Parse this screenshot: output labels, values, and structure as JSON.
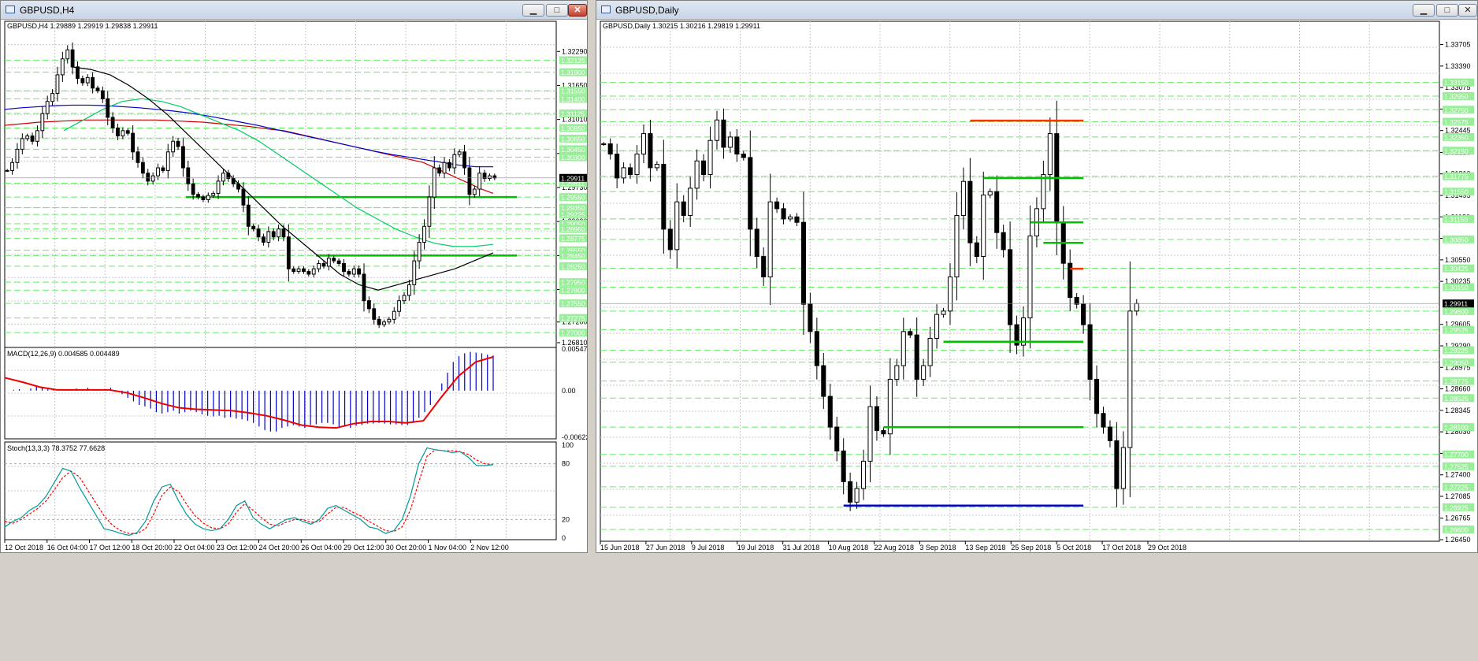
{
  "colors": {
    "ema": "#0000cc",
    "sma": "#cc0000",
    "ma50": "#000000",
    "ma20": "#00cc66",
    "level_green": "#00c000",
    "level_red": "#ff3300",
    "level_blue": "#0000cc",
    "dash_green": "#66ee66",
    "macd_hist": "#0000cc",
    "macd_signal": "#ee0000",
    "stoch_main": "#009999",
    "stoch_signal": "#ff0000",
    "badge": "#99ee99"
  },
  "left": {
    "title": "GBPUSD,H4",
    "info": "GBPUSD,H4  1.29889 1.29919 1.29838 1.29911",
    "price_min": 1.2681,
    "price_max": 1.3265,
    "price_axis": [
      "1.32290",
      "1.31650",
      "1.31010",
      "1.30370",
      "1.29730",
      "1.29090",
      "1.28450",
      "1.27810",
      "1.27200",
      "1.26810"
    ],
    "price_badges": [
      "1.32125",
      "1.31900",
      "1.31550",
      "1.31400",
      "1.31125",
      "1.30850",
      "1.30650",
      "1.30450",
      "1.30300",
      "1.29811",
      "1.29550",
      "1.29350",
      "1.29225",
      "1.29050",
      "1.28950",
      "1.28775",
      "1.28550",
      "1.28450",
      "1.28250",
      "1.27950",
      "1.27800",
      "1.27550",
      "1.27275",
      "1.27000"
    ],
    "current_price": "1.29911",
    "green_levels": [
      1.2955,
      1.2845
    ],
    "candles": [
      1.3005,
      1.302,
      1.3045,
      1.3065,
      1.307,
      1.306,
      1.308,
      1.3112,
      1.3135,
      1.315,
      1.3185,
      1.3215,
      1.3232,
      1.32,
      1.3178,
      1.317,
      1.318,
      1.316,
      1.3155,
      1.314,
      1.3105,
      1.3085,
      1.307,
      1.308,
      1.3075,
      1.304,
      1.302,
      1.3,
      1.2985,
      1.2995,
      1.301,
      1.3005,
      1.304,
      1.306,
      1.305,
      1.301,
      1.298,
      1.296,
      1.2955,
      1.295,
      1.2958,
      1.2962,
      1.2985,
      1.3,
      1.299,
      1.298,
      1.297,
      1.294,
      1.29,
      1.2895,
      1.288,
      1.287,
      1.289,
      1.288,
      1.2895,
      1.288,
      1.282,
      1.2815,
      1.282,
      1.2815,
      1.281,
      1.282,
      1.283,
      1.2825,
      1.284,
      1.2835,
      1.283,
      1.2815,
      1.281,
      1.282,
      1.281,
      1.276,
      1.2745,
      1.2725,
      1.2715,
      1.272,
      1.2725,
      1.274,
      1.276,
      1.277,
      1.279,
      1.2835,
      1.287,
      1.29,
      1.2955,
      1.301,
      1.3,
      1.302,
      1.301,
      1.3035,
      1.304,
      1.301,
      1.296,
      1.297,
      1.3,
      1.299,
      1.2995,
      1.2991
    ],
    "sma": [
      1.309,
      1.3092,
      1.3094,
      1.3096,
      1.3097,
      1.3098,
      1.3099,
      1.31,
      1.31,
      1.31,
      1.31,
      1.31,
      1.31,
      1.31,
      1.3099,
      1.3098,
      1.3097,
      1.3096,
      1.3094,
      1.3092,
      1.309,
      1.3088,
      1.3085,
      1.3082,
      1.308,
      1.3075,
      1.307,
      1.3065,
      1.306,
      1.3055,
      1.305,
      1.3045,
      1.304,
      1.3035,
      1.303,
      1.3025,
      1.302,
      1.301,
      1.3,
      1.299,
      1.298,
      1.297,
      1.2962
    ],
    "ema": [
      1.312,
      1.3123,
      1.3125,
      1.3127,
      1.3128,
      1.3128,
      1.3127,
      1.3125,
      1.3123,
      1.312,
      1.3117,
      1.3113,
      1.3108,
      1.3102,
      1.3096,
      1.309,
      1.3083,
      1.3076,
      1.3069,
      1.3062,
      1.3055,
      1.3048,
      1.3041,
      1.3035,
      1.303,
      1.3025,
      1.302,
      1.3015,
      1.3012,
      1.3012
    ],
    "ma20": [
      1.308,
      1.31,
      1.312,
      1.3135,
      1.314,
      1.3135,
      1.3125,
      1.311,
      1.3095,
      1.308,
      1.306,
      1.3035,
      1.301,
      1.2985,
      1.296,
      1.2935,
      1.2915,
      1.2895,
      1.288,
      1.2868,
      1.2862,
      1.2862,
      1.2866
    ],
    "ma50": [
      1.32,
      1.3195,
      1.3185,
      1.3165,
      1.314,
      1.311,
      1.3075,
      1.304,
      1.3005,
      1.297,
      1.2935,
      1.29,
      1.287,
      1.284,
      1.281,
      1.279,
      1.278,
      1.279,
      1.28,
      1.281,
      1.282,
      1.2835,
      1.285
    ],
    "macd": {
      "label": "MACD(12,26,9) 0.004585 0.004489",
      "axis": [
        "0.005474",
        "0.00",
        "-0.006227"
      ],
      "min": -0.0065,
      "max": 0.0058,
      "hist": [
        -0.0,
        0.0001,
        0.0002,
        0.0,
        0.0003,
        0.0006,
        0.0004,
        0.0003,
        0.0002,
        0.0,
        0.0001,
        0.0002,
        0.0003,
        0.0002,
        0.0004,
        0.0002,
        0.0001,
        0.0002,
        0.0004,
        0.0,
        -0.0005,
        -0.001,
        -0.0015,
        -0.002,
        -0.0022,
        -0.0025,
        -0.003,
        -0.0032,
        -0.003,
        -0.0028,
        -0.0032,
        -0.003,
        -0.0028,
        -0.003,
        -0.0033,
        -0.0035,
        -0.0036,
        -0.0035,
        -0.0038,
        -0.0037,
        -0.0039,
        -0.004,
        -0.0042,
        -0.0045,
        -0.005,
        -0.0055,
        -0.0057,
        -0.0057,
        -0.0052,
        -0.005,
        -0.0048,
        -0.005,
        -0.0052,
        -0.0048,
        -0.0047,
        -0.0045,
        -0.0045,
        -0.0047,
        -0.005,
        -0.005,
        -0.0052,
        -0.0049,
        -0.0048,
        -0.0046,
        -0.0046,
        -0.0045,
        -0.0046,
        -0.0047,
        -0.0047,
        -0.0048,
        -0.0048,
        -0.0045,
        -0.0038,
        -0.003,
        -0.002,
        0.0,
        0.001,
        0.0025,
        0.004,
        0.0048,
        0.0052,
        0.0054,
        0.0053,
        0.0052,
        0.005,
        0.0049
      ],
      "signal": [
        0.0018,
        0.0012,
        0.0005,
        0.0001,
        0.0001,
        0.0001,
        0.0001,
        -0.0003,
        -0.001,
        -0.0018,
        -0.0024,
        -0.0026,
        -0.0027,
        -0.0028,
        -0.0031,
        -0.0035,
        -0.0041,
        -0.0048,
        -0.0051,
        -0.0052,
        -0.0046,
        -0.0043,
        -0.0043,
        -0.0045,
        -0.0042,
        -0.001,
        0.002,
        0.004,
        0.0047
      ]
    },
    "stoch": {
      "label": "Stoch(13,3,3) 78.3752 77.6628",
      "axis": [
        "100",
        "80",
        "20",
        "0"
      ],
      "main": [
        12,
        18,
        22,
        30,
        35,
        45,
        60,
        75,
        72,
        55,
        40,
        25,
        10,
        8,
        5,
        3,
        6,
        18,
        40,
        55,
        58,
        40,
        25,
        15,
        10,
        8,
        10,
        20,
        35,
        40,
        22,
        15,
        10,
        15,
        20,
        22,
        18,
        15,
        20,
        32,
        35,
        30,
        25,
        20,
        12,
        10,
        5,
        8,
        20,
        45,
        80,
        97,
        95,
        94,
        92,
        93,
        87,
        78,
        78,
        79
      ],
      "signal": [
        18,
        16,
        20,
        26,
        32,
        40,
        52,
        65,
        72,
        66,
        52,
        38,
        24,
        14,
        8,
        5,
        5,
        10,
        26,
        46,
        55,
        50,
        36,
        24,
        16,
        11,
        10,
        15,
        28,
        37,
        30,
        22,
        15,
        13,
        17,
        20,
        20,
        17,
        18,
        26,
        33,
        33,
        28,
        24,
        18,
        13,
        8,
        7,
        12,
        30,
        60,
        88,
        95,
        94,
        94,
        93,
        90,
        84,
        80,
        79
      ]
    },
    "time_labels": [
      "12 Oct 2018",
      "16 Oct 04:00",
      "17 Oct 12:00",
      "18 Oct 20:00",
      "22 Oct 04:00",
      "23 Oct 12:00",
      "24 Oct 20:00",
      "26 Oct 04:00",
      "29 Oct 12:00",
      "30 Oct 20:00",
      "1 Nov 04:00",
      "2 Nov 12:00"
    ]
  },
  "right": {
    "title": "GBPUSD,Daily",
    "info": "GBPUSD,Daily  1.30215 1.30216 1.29819 1.29911",
    "price_min": 1.2645,
    "price_max": 1.34,
    "price_axis": [
      "1.33705",
      "1.33390",
      "1.33075",
      "1.32760",
      "1.32445",
      "1.32125",
      "1.31810",
      "1.31495",
      "1.31180",
      "1.30865",
      "1.30550",
      "1.30235",
      "1.29605",
      "1.29290",
      "1.28975",
      "1.28660",
      "1.28345",
      "1.28030",
      "1.27715",
      "1.27400",
      "1.27085",
      "1.26765",
      "1.26450"
    ],
    "price_badges": [
      "1.33150",
      "1.32950",
      "1.32750",
      "1.32575",
      "1.32350",
      "1.32150",
      "1.31775",
      "1.31550",
      "1.31150",
      "1.30850",
      "1.30425",
      "1.30150",
      "1.29800",
      "1.29525",
      "1.29225",
      "1.29050",
      "1.28775",
      "1.28525",
      "1.28100",
      "1.27700",
      "1.27525",
      "1.27225",
      "1.26925",
      "1.26600"
    ],
    "current_price": "1.29911",
    "levels": [
      {
        "from": 55,
        "to": 72,
        "price": 1.3259,
        "color": "red"
      },
      {
        "from": 57,
        "to": 72,
        "price": 1.3175,
        "color": "green"
      },
      {
        "from": 64,
        "to": 72,
        "price": 1.311,
        "color": "green"
      },
      {
        "from": 66,
        "to": 72,
        "price": 1.308,
        "color": "green"
      },
      {
        "from": 70,
        "to": 72,
        "price": 1.3042,
        "color": "red"
      },
      {
        "from": 51,
        "to": 72,
        "price": 1.2935,
        "color": "green"
      },
      {
        "from": 42,
        "to": 72,
        "price": 1.281,
        "color": "green"
      },
      {
        "from": 36,
        "to": 72,
        "price": 1.2695,
        "color": "blue"
      }
    ],
    "candles": [
      1.3225,
      1.321,
      1.3175,
      1.319,
      1.318,
      1.321,
      1.324,
      1.319,
      1.3195,
      1.31,
      1.307,
      1.314,
      1.312,
      1.316,
      1.32,
      1.318,
      1.323,
      1.326,
      1.322,
      1.3235,
      1.321,
      1.3205,
      1.31,
      1.306,
      1.303,
      1.314,
      1.313,
      1.3115,
      1.3118,
      1.311,
      1.299,
      1.295,
      1.29,
      1.2855,
      1.281,
      1.2775,
      1.273,
      1.27,
      1.272,
      1.276,
      1.284,
      1.2805,
      1.28,
      1.288,
      1.29,
      1.295,
      1.2945,
      1.288,
      1.29,
      1.294,
      1.2975,
      1.298,
      1.303,
      1.312,
      1.317,
      1.308,
      1.306,
      1.315,
      1.3155,
      1.3095,
      1.307,
      1.296,
      1.293,
      1.297,
      1.309,
      1.313,
      1.318,
      1.324,
      1.311,
      1.305,
      1.3,
      1.299,
      1.296,
      1.288,
      1.283,
      1.281,
      1.279,
      1.272,
      1.278,
      1.298,
      1.2991
    ],
    "time_labels": [
      "15 Jun 2018",
      "27 Jun 2018",
      "9 Jul 2018",
      "19 Jul 2018",
      "31 Jul 2018",
      "10 Aug 2018",
      "22 Aug 2018",
      "3 Sep 2018",
      "13 Sep 2018",
      "25 Sep 2018",
      "5 Oct 2018",
      "17 Oct 2018",
      "29 Oct 2018"
    ]
  }
}
